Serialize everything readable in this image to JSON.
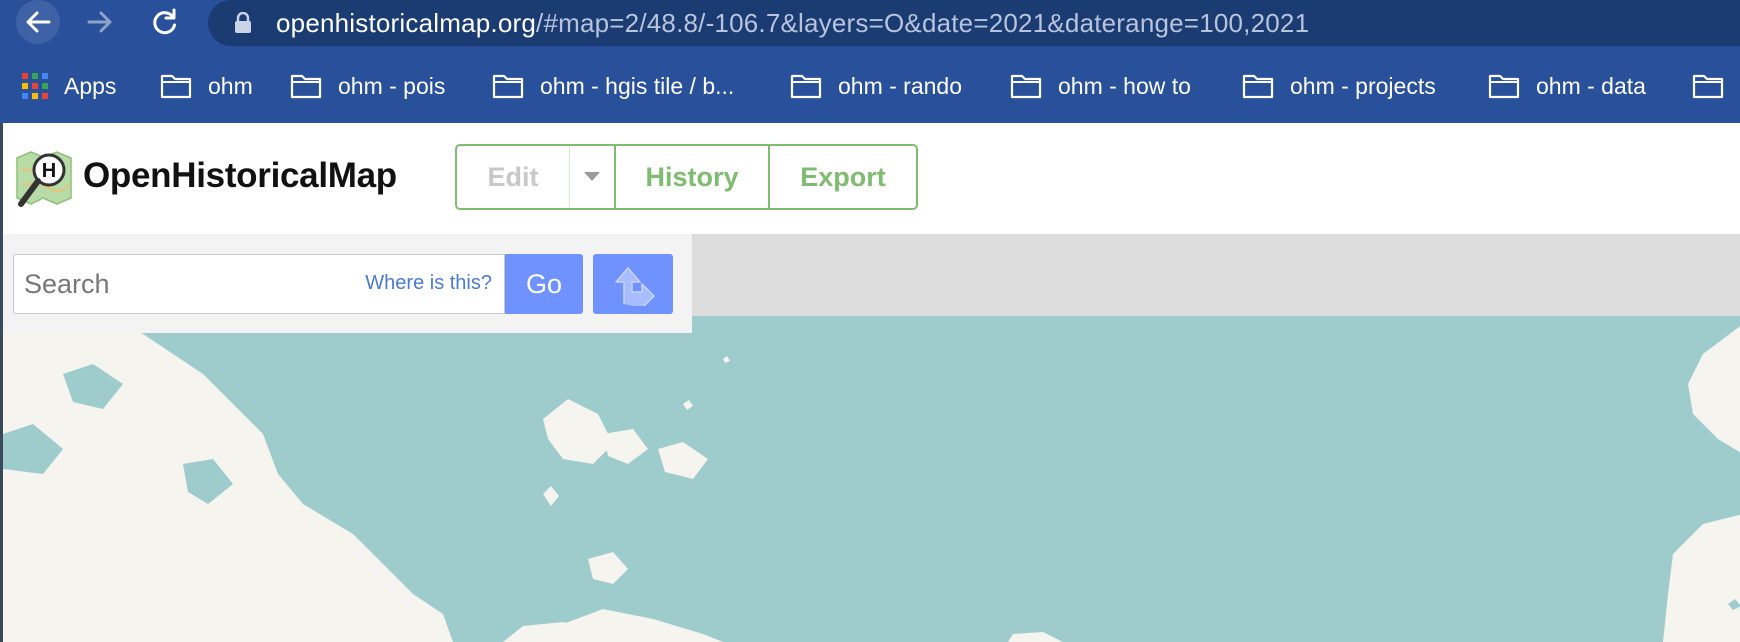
{
  "browser": {
    "url_host": "openhistoricalmap.org",
    "url_rest": "/#map=2/48.8/-106.7&layers=O&date=2021&daterange=100,2021",
    "bookmarks": [
      {
        "label": "Apps",
        "icon": "apps-grid-icon"
      },
      {
        "label": "ohm",
        "icon": "folder-icon"
      },
      {
        "label": "ohm - pois",
        "icon": "folder-icon"
      },
      {
        "label": "ohm - hgis tile / b...",
        "icon": "folder-icon"
      },
      {
        "label": "ohm - rando",
        "icon": "folder-icon"
      },
      {
        "label": "ohm - how to",
        "icon": "folder-icon"
      },
      {
        "label": "ohm - projects",
        "icon": "folder-icon"
      },
      {
        "label": "ohm - data",
        "icon": "folder-icon"
      },
      {
        "label": "",
        "icon": "folder-icon"
      }
    ],
    "colors": {
      "chrome": "#29519b",
      "omnibox": "#1b3b73"
    }
  },
  "header": {
    "brand": "OpenHistoricalMap",
    "logo_letter": "H",
    "buttons": {
      "edit": "Edit",
      "history": "History",
      "export": "Export"
    },
    "colors": {
      "accent": "#7ebc6f",
      "disabled": "#c8c8c8"
    }
  },
  "search": {
    "placeholder": "Search",
    "where_is_this": "Where is this?",
    "go": "Go",
    "directions_icon": "directions-arrow-icon",
    "colors": {
      "button": "#7092ff",
      "link": "#4a7ad4"
    }
  },
  "map": {
    "colors": {
      "water": "#9ecbcb",
      "land": "#f5f4ef",
      "strip": "#dddddd"
    }
  }
}
